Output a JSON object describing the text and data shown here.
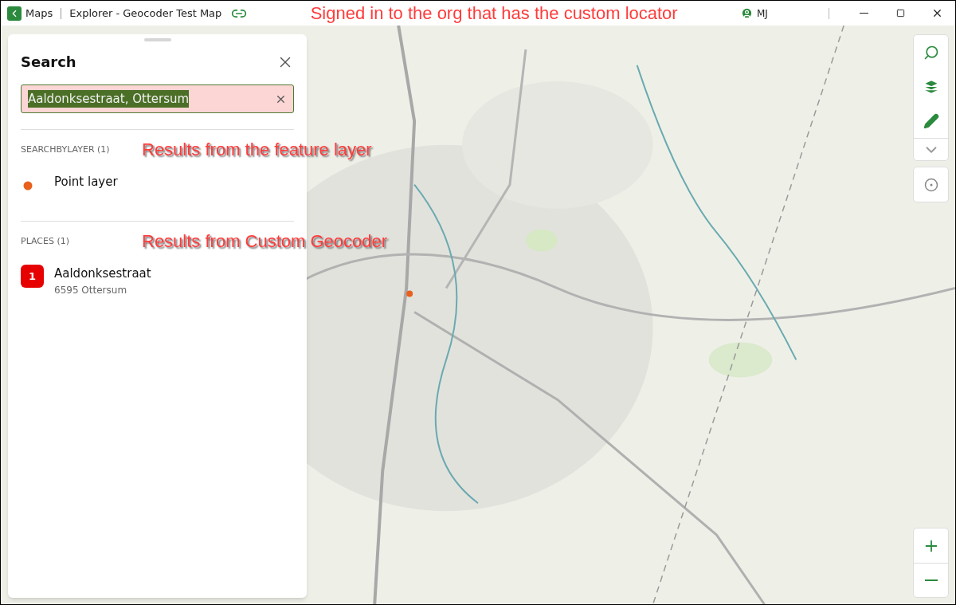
{
  "titlebar": {
    "back": "Maps",
    "title": "Explorer - Geocoder Test Map",
    "user": "MJ"
  },
  "annotations": [
    {
      "text": "Signed in to the org that has the custom locator",
      "kind": "title"
    },
    {
      "text": "Results from the feature layer",
      "kind": "panel"
    },
    {
      "text": "Results from Custom Geocoder",
      "kind": "panel"
    }
  ],
  "search_panel": {
    "title": "Search",
    "query": "Aaldonksestraat, Ottersum",
    "query_selected": true,
    "groups": [
      {
        "heading": "SEARCHBYLAYER (1)",
        "results": [
          {
            "kind": "point",
            "title": "Point layer"
          }
        ]
      },
      {
        "heading": "PLACES (1)",
        "results": [
          {
            "kind": "numbered",
            "marker": "1",
            "title": "Aaldonksestraat",
            "subtitle": "6595 Ottersum"
          }
        ]
      }
    ]
  }
}
